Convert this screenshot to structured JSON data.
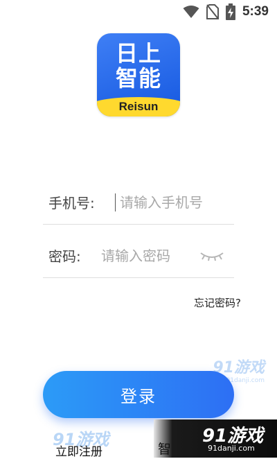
{
  "status_bar": {
    "time": "5:39",
    "icons": [
      "wifi-icon",
      "no-sim-icon",
      "battery-charging-icon"
    ]
  },
  "logo": {
    "line1": "日上",
    "line2": "智能",
    "brand": "Reisun",
    "colors": {
      "primary": "#1558e0",
      "band": "#ffd92e"
    }
  },
  "form": {
    "phone": {
      "label": "手机号:",
      "placeholder": "请输入手机号"
    },
    "password": {
      "label": "密码:",
      "placeholder": "请输入密码",
      "toggle_icon": "eye-closed-icon"
    },
    "forgot_label": "忘记密码?"
  },
  "login_button": {
    "label": "登录",
    "color": "#2d7ff6"
  },
  "register_label": "立即注册",
  "watermark": {
    "text": "91游戏",
    "sub": "91danji.com"
  },
  "partial_text": "智"
}
